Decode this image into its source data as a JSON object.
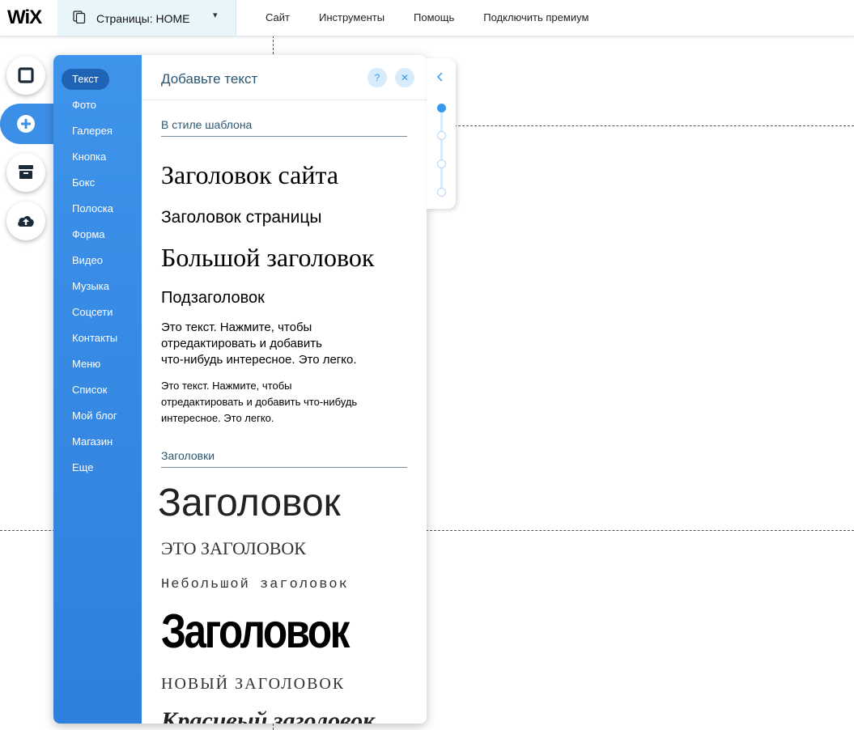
{
  "topbar": {
    "logo": "WiX",
    "pages_label": "Страницы: HOME",
    "menu": [
      "Сайт",
      "Инструменты",
      "Помощь",
      "Подключить премиум"
    ]
  },
  "rail": {
    "icons": [
      "square-icon",
      "plus-icon",
      "store-icon",
      "cloud-upload-icon"
    ]
  },
  "panel": {
    "categories": [
      "Текст",
      "Фото",
      "Галерея",
      "Кнопка",
      "Бокс",
      "Полоска",
      "Форма",
      "Видео",
      "Музыка",
      "Соцсети",
      "Контакты",
      "Меню",
      "Список",
      "Мой блог",
      "Магазин",
      "Еще"
    ],
    "selected_category": "Текст",
    "title": "Добавьте текст",
    "help_label": "?",
    "close_label": "✕",
    "template_section": {
      "title": "В стиле шаблона",
      "items": [
        "Заголовок сайта",
        "Заголовок страницы",
        "Большой заголовок",
        "Подзаголовок"
      ],
      "paragraph_1": [
        "Это текст. Нажмите, чтобы",
        "отредактировать и добавить",
        "что-нибудь интересное. Это легко."
      ],
      "paragraph_2": [
        "Это текст. Нажмите, чтобы",
        "отредактировать и добавить что-нибудь",
        "интересное. Это легко."
      ]
    },
    "headings_section": {
      "title": "Заголовки",
      "items": [
        "Заголовок",
        "ЭТО ЗАГОЛОВОК",
        "Небольшой заголовок",
        "Заголовок",
        "НОВЫЙ ЗАГОЛОВОК",
        "Красивый заголовок"
      ]
    }
  },
  "colors": {
    "accent": "#3899ec",
    "panel_blue": "#3c8fe6",
    "selected": "#1f63b6"
  }
}
